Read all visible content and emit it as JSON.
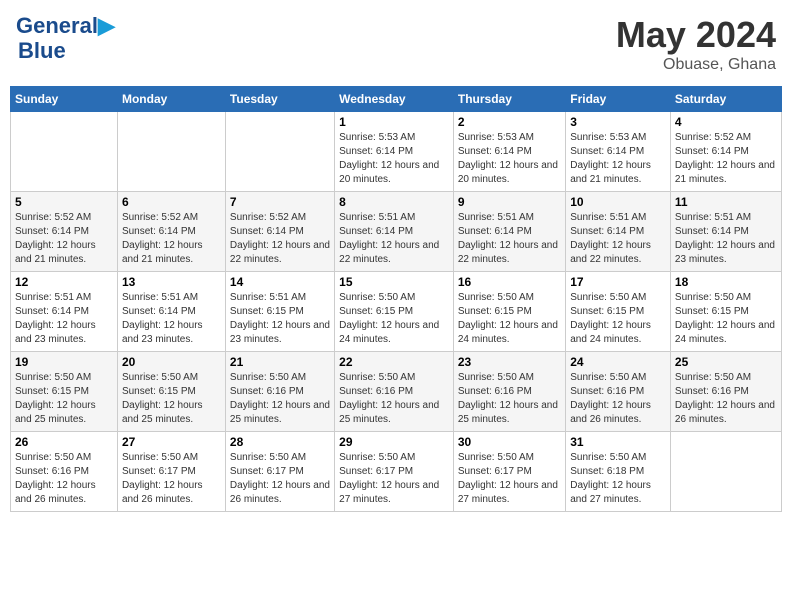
{
  "logo": {
    "line1": "General",
    "line2": "Blue"
  },
  "title": "May 2024",
  "location": "Obuase, Ghana",
  "days_of_week": [
    "Sunday",
    "Monday",
    "Tuesday",
    "Wednesday",
    "Thursday",
    "Friday",
    "Saturday"
  ],
  "weeks": [
    [
      {
        "day": "",
        "sunrise": "",
        "sunset": "",
        "daylight": ""
      },
      {
        "day": "",
        "sunrise": "",
        "sunset": "",
        "daylight": ""
      },
      {
        "day": "",
        "sunrise": "",
        "sunset": "",
        "daylight": ""
      },
      {
        "day": "1",
        "sunrise": "Sunrise: 5:53 AM",
        "sunset": "Sunset: 6:14 PM",
        "daylight": "Daylight: 12 hours and 20 minutes."
      },
      {
        "day": "2",
        "sunrise": "Sunrise: 5:53 AM",
        "sunset": "Sunset: 6:14 PM",
        "daylight": "Daylight: 12 hours and 20 minutes."
      },
      {
        "day": "3",
        "sunrise": "Sunrise: 5:53 AM",
        "sunset": "Sunset: 6:14 PM",
        "daylight": "Daylight: 12 hours and 21 minutes."
      },
      {
        "day": "4",
        "sunrise": "Sunrise: 5:52 AM",
        "sunset": "Sunset: 6:14 PM",
        "daylight": "Daylight: 12 hours and 21 minutes."
      }
    ],
    [
      {
        "day": "5",
        "sunrise": "Sunrise: 5:52 AM",
        "sunset": "Sunset: 6:14 PM",
        "daylight": "Daylight: 12 hours and 21 minutes."
      },
      {
        "day": "6",
        "sunrise": "Sunrise: 5:52 AM",
        "sunset": "Sunset: 6:14 PM",
        "daylight": "Daylight: 12 hours and 21 minutes."
      },
      {
        "day": "7",
        "sunrise": "Sunrise: 5:52 AM",
        "sunset": "Sunset: 6:14 PM",
        "daylight": "Daylight: 12 hours and 22 minutes."
      },
      {
        "day": "8",
        "sunrise": "Sunrise: 5:51 AM",
        "sunset": "Sunset: 6:14 PM",
        "daylight": "Daylight: 12 hours and 22 minutes."
      },
      {
        "day": "9",
        "sunrise": "Sunrise: 5:51 AM",
        "sunset": "Sunset: 6:14 PM",
        "daylight": "Daylight: 12 hours and 22 minutes."
      },
      {
        "day": "10",
        "sunrise": "Sunrise: 5:51 AM",
        "sunset": "Sunset: 6:14 PM",
        "daylight": "Daylight: 12 hours and 22 minutes."
      },
      {
        "day": "11",
        "sunrise": "Sunrise: 5:51 AM",
        "sunset": "Sunset: 6:14 PM",
        "daylight": "Daylight: 12 hours and 23 minutes."
      }
    ],
    [
      {
        "day": "12",
        "sunrise": "Sunrise: 5:51 AM",
        "sunset": "Sunset: 6:14 PM",
        "daylight": "Daylight: 12 hours and 23 minutes."
      },
      {
        "day": "13",
        "sunrise": "Sunrise: 5:51 AM",
        "sunset": "Sunset: 6:14 PM",
        "daylight": "Daylight: 12 hours and 23 minutes."
      },
      {
        "day": "14",
        "sunrise": "Sunrise: 5:51 AM",
        "sunset": "Sunset: 6:15 PM",
        "daylight": "Daylight: 12 hours and 23 minutes."
      },
      {
        "day": "15",
        "sunrise": "Sunrise: 5:50 AM",
        "sunset": "Sunset: 6:15 PM",
        "daylight": "Daylight: 12 hours and 24 minutes."
      },
      {
        "day": "16",
        "sunrise": "Sunrise: 5:50 AM",
        "sunset": "Sunset: 6:15 PM",
        "daylight": "Daylight: 12 hours and 24 minutes."
      },
      {
        "day": "17",
        "sunrise": "Sunrise: 5:50 AM",
        "sunset": "Sunset: 6:15 PM",
        "daylight": "Daylight: 12 hours and 24 minutes."
      },
      {
        "day": "18",
        "sunrise": "Sunrise: 5:50 AM",
        "sunset": "Sunset: 6:15 PM",
        "daylight": "Daylight: 12 hours and 24 minutes."
      }
    ],
    [
      {
        "day": "19",
        "sunrise": "Sunrise: 5:50 AM",
        "sunset": "Sunset: 6:15 PM",
        "daylight": "Daylight: 12 hours and 25 minutes."
      },
      {
        "day": "20",
        "sunrise": "Sunrise: 5:50 AM",
        "sunset": "Sunset: 6:15 PM",
        "daylight": "Daylight: 12 hours and 25 minutes."
      },
      {
        "day": "21",
        "sunrise": "Sunrise: 5:50 AM",
        "sunset": "Sunset: 6:16 PM",
        "daylight": "Daylight: 12 hours and 25 minutes."
      },
      {
        "day": "22",
        "sunrise": "Sunrise: 5:50 AM",
        "sunset": "Sunset: 6:16 PM",
        "daylight": "Daylight: 12 hours and 25 minutes."
      },
      {
        "day": "23",
        "sunrise": "Sunrise: 5:50 AM",
        "sunset": "Sunset: 6:16 PM",
        "daylight": "Daylight: 12 hours and 25 minutes."
      },
      {
        "day": "24",
        "sunrise": "Sunrise: 5:50 AM",
        "sunset": "Sunset: 6:16 PM",
        "daylight": "Daylight: 12 hours and 26 minutes."
      },
      {
        "day": "25",
        "sunrise": "Sunrise: 5:50 AM",
        "sunset": "Sunset: 6:16 PM",
        "daylight": "Daylight: 12 hours and 26 minutes."
      }
    ],
    [
      {
        "day": "26",
        "sunrise": "Sunrise: 5:50 AM",
        "sunset": "Sunset: 6:16 PM",
        "daylight": "Daylight: 12 hours and 26 minutes."
      },
      {
        "day": "27",
        "sunrise": "Sunrise: 5:50 AM",
        "sunset": "Sunset: 6:17 PM",
        "daylight": "Daylight: 12 hours and 26 minutes."
      },
      {
        "day": "28",
        "sunrise": "Sunrise: 5:50 AM",
        "sunset": "Sunset: 6:17 PM",
        "daylight": "Daylight: 12 hours and 26 minutes."
      },
      {
        "day": "29",
        "sunrise": "Sunrise: 5:50 AM",
        "sunset": "Sunset: 6:17 PM",
        "daylight": "Daylight: 12 hours and 27 minutes."
      },
      {
        "day": "30",
        "sunrise": "Sunrise: 5:50 AM",
        "sunset": "Sunset: 6:17 PM",
        "daylight": "Daylight: 12 hours and 27 minutes."
      },
      {
        "day": "31",
        "sunrise": "Sunrise: 5:50 AM",
        "sunset": "Sunset: 6:18 PM",
        "daylight": "Daylight: 12 hours and 27 minutes."
      },
      {
        "day": "",
        "sunrise": "",
        "sunset": "",
        "daylight": ""
      }
    ]
  ]
}
